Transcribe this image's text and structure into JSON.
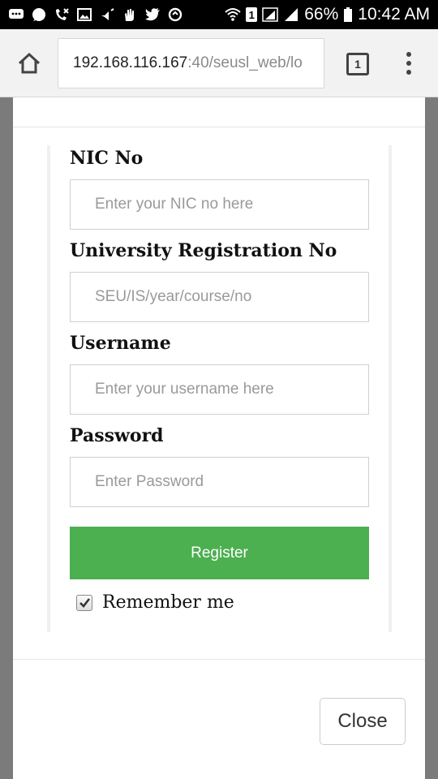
{
  "status_bar": {
    "battery_percent": "66%",
    "time": "10:42 AM",
    "sim_indicator": "1",
    "left_icons": [
      "chat-bubble-icon",
      "chat-icon",
      "missed-call-icon",
      "image-icon",
      "silent-icon",
      "hand-icon",
      "twitter-icon",
      "sync-icon"
    ],
    "right_icons": [
      "wifi-icon",
      "sim-icon",
      "signal-icon",
      "signal-icon",
      "battery-icon"
    ]
  },
  "browser": {
    "url_host": "192.168.116.167",
    "url_path": ":40/seusl_web/lo",
    "tab_count": "1"
  },
  "form": {
    "nic_label": "NIC No",
    "nic_placeholder": "Enter your NIC no here",
    "reg_label": "University Registration No",
    "reg_placeholder": "SEU/IS/year/course/no",
    "username_label": "Username",
    "username_placeholder": "Enter your username here",
    "password_label": "Password",
    "password_placeholder": "Enter Password",
    "register_label": "Register",
    "remember_label": "Remember me",
    "remember_checked": true
  },
  "footer": {
    "close_label": "Close"
  },
  "colors": {
    "register_button": "#4caf50",
    "backdrop": "#7b7b7b"
  }
}
